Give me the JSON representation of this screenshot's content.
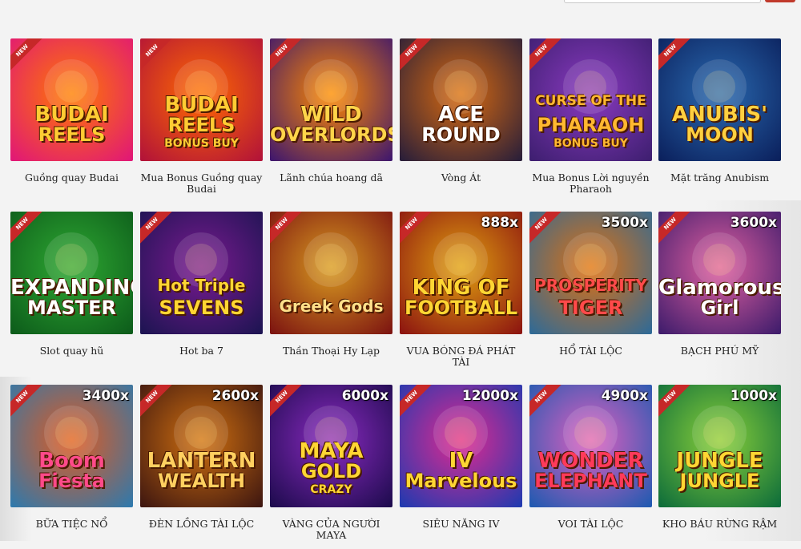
{
  "header": {
    "search_placeholder": ""
  },
  "ribbon_label": "NEW",
  "games": [
    {
      "name": "Guồng quay Budai",
      "art": [
        "BUDAI",
        "REELS",
        ""
      ],
      "multiplier": "",
      "colors": [
        "#e0147a",
        "#ff7a00"
      ],
      "title_color": "#ffcc33"
    },
    {
      "name": "Mua Bonus Guồng quay Budai",
      "art": [
        "BUDAI",
        "REELS",
        "BONUS BUY"
      ],
      "multiplier": "",
      "colors": [
        "#b0103a",
        "#ff6a00"
      ],
      "title_color": "#ffcc33"
    },
    {
      "name": "Lãnh chúa hoang dã",
      "art": [
        "WILD",
        "OVERLORDS",
        ""
      ],
      "multiplier": "",
      "colors": [
        "#3a1470",
        "#ff8a00"
      ],
      "title_color": "#ffd54a"
    },
    {
      "name": "Vòng Át",
      "art": [
        "ACE",
        "ROUND",
        ""
      ],
      "multiplier": "",
      "colors": [
        "#241c3a",
        "#d86a10"
      ],
      "title_color": "#ffffff"
    },
    {
      "name": "Mua Bonus Lời nguyền Pharaoh",
      "art": [
        "CURSE OF THE",
        "PHARAOH",
        "BONUS BUY"
      ],
      "multiplier": "",
      "colors": [
        "#3c1e6e",
        "#8a3ac0"
      ],
      "title_color": "#ffb830"
    },
    {
      "name": "Mặt trăng Anubism",
      "art": [
        "ANUBIS'",
        "MOON",
        ""
      ],
      "multiplier": "",
      "colors": [
        "#0a1e5a",
        "#2a6ab0"
      ],
      "title_color": "#ffd040"
    },
    {
      "name": "Slot quay hũ",
      "art": [
        "EXPANDING",
        "MASTER",
        ""
      ],
      "multiplier": "",
      "colors": [
        "#0c5a1a",
        "#2ea832"
      ],
      "title_color": "#ffffff"
    },
    {
      "name": "Hot ba 7",
      "art": [
        "Hot Triple",
        "SEVENS",
        ""
      ],
      "multiplier": "",
      "colors": [
        "#1a1450",
        "#7a1a90"
      ],
      "title_color": "#ffd633"
    },
    {
      "name": "Thần Thoại Hy Lạp",
      "art": [
        "Greek Gods",
        "",
        ""
      ],
      "multiplier": "",
      "colors": [
        "#7a1010",
        "#d89a20"
      ],
      "title_color": "#ffe08a"
    },
    {
      "name": "VUA BÓNG ĐÁ PHÁT TÀI",
      "art": [
        "KING OF",
        "FOOTBALL",
        ""
      ],
      "multiplier": "888x",
      "colors": [
        "#8a1010",
        "#e0a010"
      ],
      "title_color": "#ffd633"
    },
    {
      "name": "HỔ TÀI LỘC",
      "art": [
        "PROSPERITY",
        "TIGER",
        ""
      ],
      "multiplier": "3500x",
      "colors": [
        "#2a6a9a",
        "#e07010"
      ],
      "title_color": "#ff4a4a"
    },
    {
      "name": "BẠCH PHÚ MỸ",
      "art": [
        "Glamorous",
        "Girl",
        ""
      ],
      "multiplier": "3600x",
      "colors": [
        "#3a1a6a",
        "#e060a0"
      ],
      "title_color": "#ffffff"
    },
    {
      "name": "BỮA TIỆC NỔ",
      "art": [
        "Boom",
        "Fiesta",
        ""
      ],
      "multiplier": "3400x",
      "colors": [
        "#2a7ab0",
        "#e05a20"
      ],
      "title_color": "#ff4a8a"
    },
    {
      "name": "ĐÈN LỒNG TÀI LỘC",
      "art": [
        "LANTERN",
        "WEALTH",
        ""
      ],
      "multiplier": "2600x",
      "colors": [
        "#3a1410",
        "#d07010"
      ],
      "title_color": "#ffd060"
    },
    {
      "name": "VÀNG CỦA NGƯỜI MAYA",
      "art": [
        "MAYA",
        "GOLD",
        "CRAZY"
      ],
      "multiplier": "6000x",
      "colors": [
        "#1a0a4a",
        "#8a2ac0"
      ],
      "title_color": "#ffd633"
    },
    {
      "name": "SIÊU NĂNG IV",
      "art": [
        "IV",
        "Marvelous",
        ""
      ],
      "multiplier": "12000x",
      "colors": [
        "#1a3ab0",
        "#e02a90"
      ],
      "title_color": "#ffd633"
    },
    {
      "name": "VOI TÀI LỘC",
      "art": [
        "WONDER",
        "ELEPHANT",
        ""
      ],
      "multiplier": "4900x",
      "colors": [
        "#1a5ab0",
        "#e060c0"
      ],
      "title_color": "#ff3a5a"
    },
    {
      "name": "KHO BÁU RỪNG RẬM",
      "art": [
        "JUNGLE",
        "JUNGLE",
        ""
      ],
      "multiplier": "1000x",
      "colors": [
        "#0a6a3a",
        "#8ad03a"
      ],
      "title_color": "#ffd633"
    }
  ]
}
